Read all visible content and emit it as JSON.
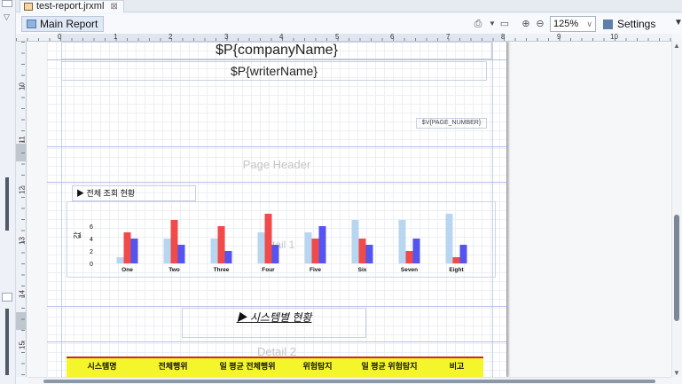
{
  "editor_tab": {
    "label": "test-report.jrxml",
    "close": "⊠"
  },
  "toolbar": {
    "main_tab_label": "Main Report",
    "zoom_value": "125%",
    "settings_label": "Settings"
  },
  "ruler": {
    "h_numbers": [
      "0",
      "1",
      "2",
      "3",
      "4",
      "5",
      "6",
      "7",
      "8",
      "9",
      "10"
    ],
    "v_numbers": [
      "10",
      "11",
      "12",
      "13",
      "14",
      "15"
    ]
  },
  "report": {
    "company_field": "$P{companyName}",
    "writer_field": "$P{writerName}",
    "page_number_field": "$V{PAGE_NUMBER}",
    "page_header_label": "Page Header",
    "detail1_label": "Detail 1",
    "detail2_label": "Detail 2",
    "chart_section_title": "▶ 전체 조회 현황",
    "system_section_title": "▶ 시스템별 현황",
    "table_headers": [
      "시스템명",
      "전체행위",
      "일 평균 전체행위",
      "위험탐지",
      "일 평균 위험탐지",
      "비고"
    ]
  },
  "chart_data": {
    "type": "bar",
    "title": "▶ 전체 조회 현황",
    "categories": [
      "One",
      "Two",
      "Three",
      "Four",
      "Five",
      "Six",
      "Seven",
      "Eight"
    ],
    "series": [
      {
        "values": [
          1,
          4,
          4,
          5,
          5,
          7,
          7,
          8
        ]
      },
      {
        "values": [
          5,
          7,
          6,
          8,
          4,
          4,
          2,
          1
        ]
      },
      {
        "values": [
          4,
          3,
          2,
          3,
          6,
          3,
          4,
          3
        ]
      }
    ],
    "colors": [
      "#b9d6f0",
      "#f04a4a",
      "#5454f0"
    ],
    "ylabel": "값",
    "yticks": [
      "0",
      "2",
      "4",
      "6"
    ],
    "ylim": [
      0,
      8
    ]
  }
}
